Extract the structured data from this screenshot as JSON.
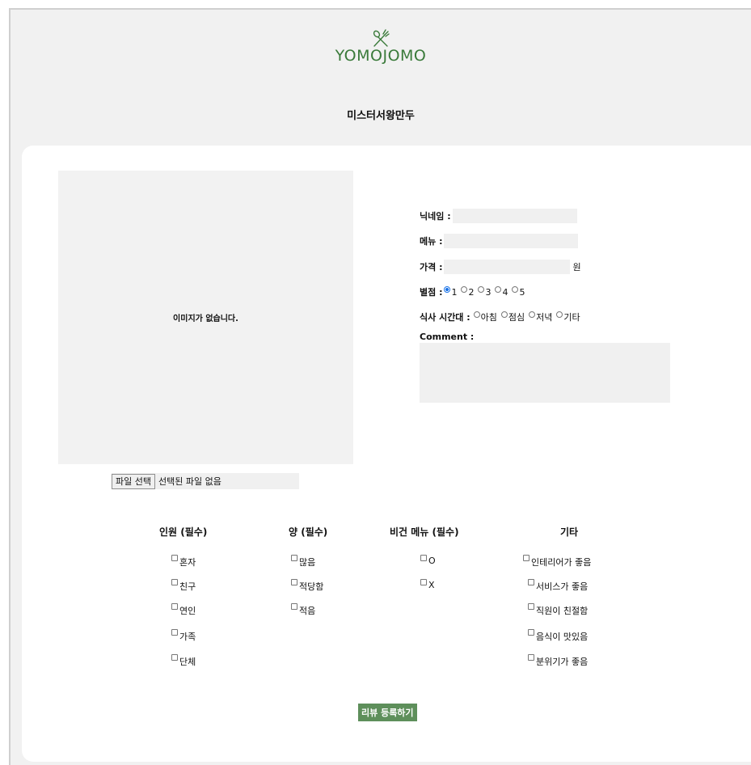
{
  "brand": {
    "logo_text": "YOMOJOMO",
    "icon": "fork-and-spoon-icon",
    "color": "#3a7a3a"
  },
  "shop_name": "미스터서왕만두",
  "image": {
    "placeholder": "이미지가 없습니다.",
    "file_button": "파일 선택",
    "file_status": "선택된 파일 없음"
  },
  "form": {
    "nickname_label": "닉네임 :",
    "menu_label": "메뉴 :",
    "price_label": "가격 :",
    "price_unit": "원",
    "rating_label": "별점 :",
    "rating_options": [
      "1",
      "2",
      "3",
      "4",
      "5"
    ],
    "rating_selected": "1",
    "mealtime_label": "식사 시간대 :",
    "mealtime_options": [
      "아침",
      "점심",
      "저녁",
      "기타"
    ],
    "comment_label": "Comment :"
  },
  "groups": {
    "people": {
      "title": "인원 (필수)",
      "items": [
        "혼자",
        "친구",
        "연인",
        "가족",
        "단체"
      ]
    },
    "amount": {
      "title": "양 (필수)",
      "items": [
        "많음",
        "적당함",
        "적음"
      ]
    },
    "vegan": {
      "title": "비건 메뉴 (필수)",
      "items": [
        "O",
        "X"
      ]
    },
    "etc": {
      "title": "기타",
      "items": [
        "인테리어가 좋음",
        "서비스가 좋음",
        "직원이 친절함",
        "음식이 맛있음",
        "분위기가 좋음"
      ]
    }
  },
  "submit_label": "리뷰 등록하기",
  "accent_color": "#5e8f5b"
}
